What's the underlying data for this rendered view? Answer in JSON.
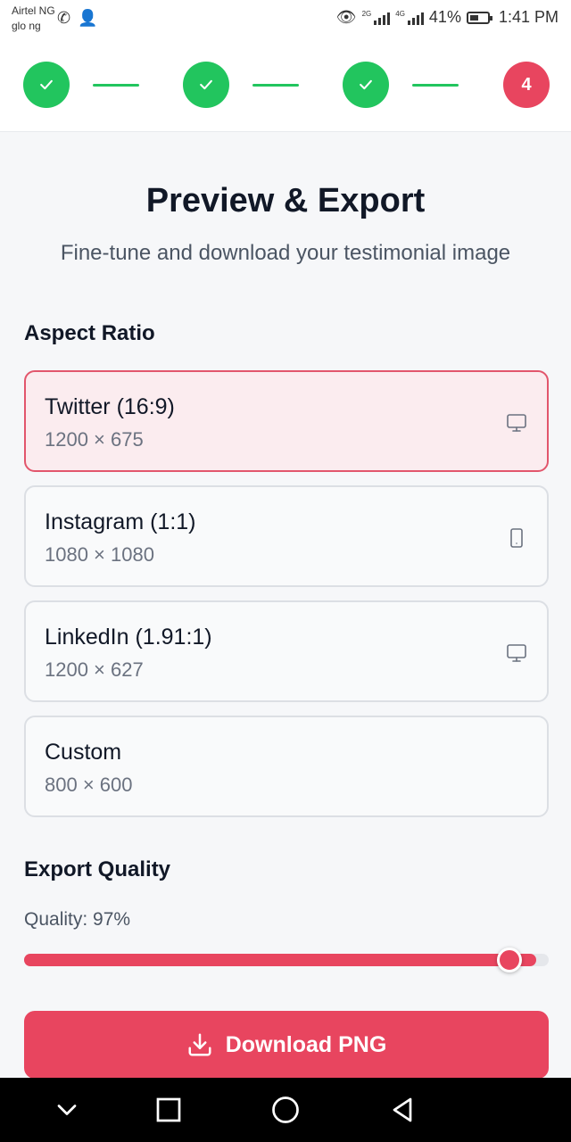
{
  "status_bar": {
    "carrier_line1": "Airtel NG",
    "carrier_line2": "glo ng",
    "app_icons": [
      "whatsapp-icon",
      "person-add-icon"
    ],
    "network1": "2G",
    "network2": "4G",
    "battery": "41%",
    "time": "1:41 PM"
  },
  "stepper": {
    "steps": [
      {
        "state": "done",
        "icon": "check-icon"
      },
      {
        "state": "done",
        "icon": "check-icon"
      },
      {
        "state": "done",
        "icon": "check-icon"
      },
      {
        "state": "current",
        "label": "4"
      }
    ],
    "colors": {
      "done": "#22c55e",
      "current": "#e8455f"
    }
  },
  "main": {
    "title": "Preview & Export",
    "subtitle": "Fine-tune and download your testimonial image",
    "aspect_ratio_label": "Aspect Ratio",
    "aspect_options": [
      {
        "name": "Twitter (16:9)",
        "size": "1200 × 675",
        "icon": "monitor-icon",
        "selected": true
      },
      {
        "name": "Instagram (1:1)",
        "size": "1080 × 1080",
        "icon": "smartphone-icon",
        "selected": false
      },
      {
        "name": "LinkedIn (1.91:1)",
        "size": "1200 × 627",
        "icon": "monitor-icon",
        "selected": false
      },
      {
        "name": "Custom",
        "size": "800 × 600",
        "icon": "",
        "selected": false
      }
    ],
    "export_quality_label": "Export Quality",
    "quality_text": "Quality: 97%",
    "quality_value": 0.97,
    "download_label": "Download PNG",
    "download_icon": "download-icon",
    "accent_color": "#e8455f"
  },
  "nav_bar": {
    "buttons": [
      "chevron-down-icon",
      "square-icon",
      "circle-icon",
      "back-triangle-icon"
    ]
  }
}
